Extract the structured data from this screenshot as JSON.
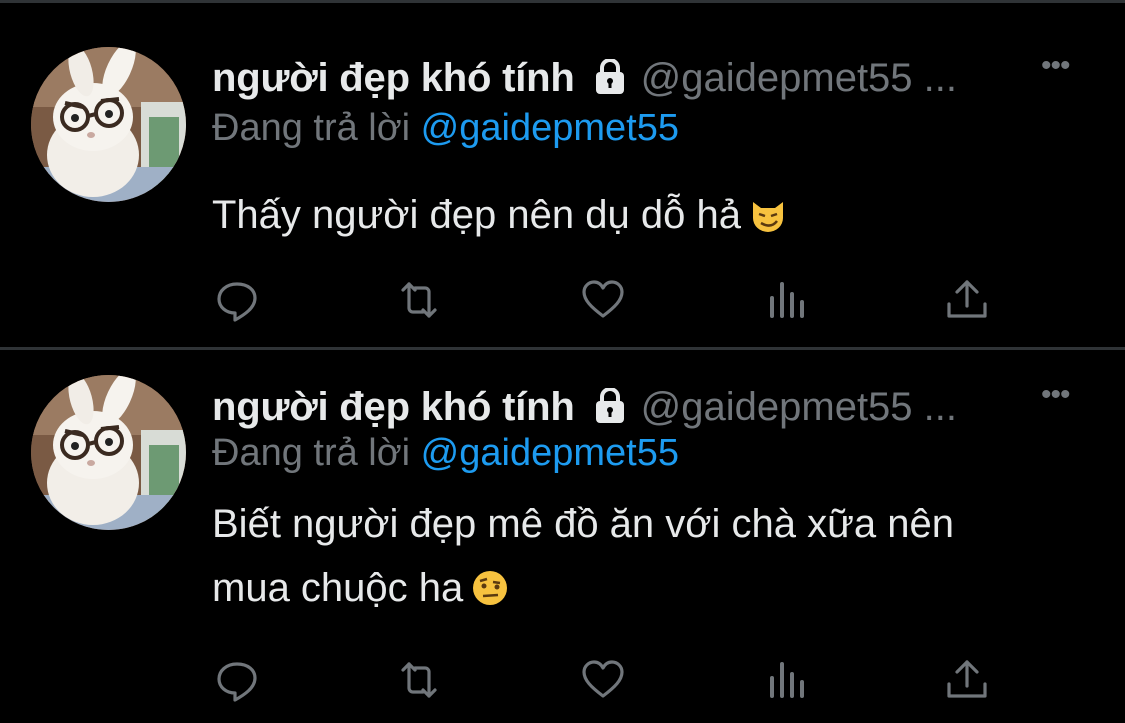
{
  "tweets": [
    {
      "display_name": "người đẹp khó tính",
      "handle": "@gaidepmet55 ...",
      "more_label": "•••",
      "replying_prefix": "Đang trả lời",
      "replying_to": "@gaidepmet55",
      "text": "Thấy người đẹp nên dụ dỗ hả",
      "emoji": "smirking-cat-emoji",
      "actions": [
        "reply-icon",
        "retweet-icon",
        "like-icon",
        "analytics-icon",
        "share-icon"
      ]
    },
    {
      "display_name": "người đẹp khó tính",
      "handle": "@gaidepmet55 ...",
      "more_label": "•••",
      "replying_prefix": "Đang trả lời",
      "replying_to": "@gaidepmet55",
      "text_line1": "Biết người đẹp mê đồ ăn với chà xữa nên",
      "text_line2": "mua chuộc ha",
      "emoji": "raised-eyebrow-emoji",
      "actions": [
        "reply-icon",
        "retweet-icon",
        "like-icon",
        "analytics-icon",
        "share-icon"
      ]
    }
  ],
  "colors": {
    "background": "#000000",
    "text": "#e7e9ea",
    "secondary": "#71767b",
    "accent": "#1d9bf0",
    "divider": "#2f3336"
  }
}
